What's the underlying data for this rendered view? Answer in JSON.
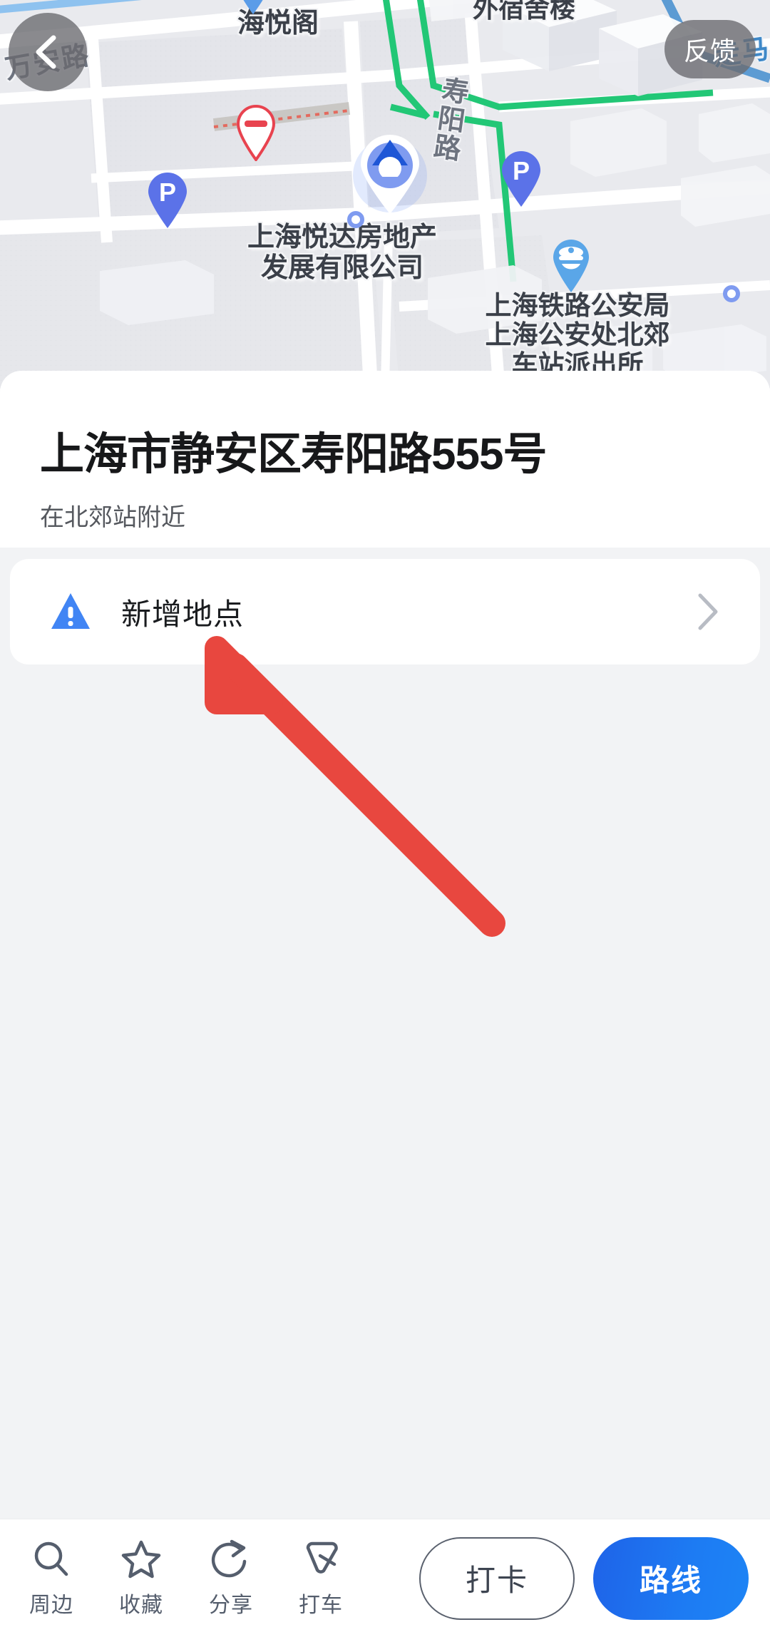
{
  "map": {
    "back_button": {
      "name": "back",
      "icon": "chevron-left-icon"
    },
    "feedback_button": {
      "label": "反馈"
    },
    "road_labels": [
      {
        "text": "万安路"
      },
      {
        "text": "寿阳路"
      },
      {
        "text": "走马"
      }
    ],
    "place_labels": [
      {
        "text": "海悦阁"
      },
      {
        "text": "外宿舍楼"
      },
      {
        "text": "上海悦达房地产\n发展有限公司"
      },
      {
        "text": "上海铁路公安局\n上海公安处北郊\n车站派出所"
      }
    ],
    "markers": [
      {
        "type": "parking-pin",
        "label": "P"
      },
      {
        "type": "parking-pin",
        "label": "P"
      },
      {
        "type": "no-entry-pin",
        "label": ""
      },
      {
        "type": "police-pin",
        "label": ""
      },
      {
        "type": "current-location-pin",
        "label": ""
      }
    ],
    "colors": {
      "pin_blue": "#5b72e8",
      "no_entry_red": "#e8434f",
      "police_blue": "#5aa6e8",
      "road_green": "#22c776",
      "road_river_blue": "#5aa0d8",
      "map_background": "#e9eaee"
    }
  },
  "sheet": {
    "title": "上海市静安区寿阳路555号",
    "subtitle": "在北郊站附近",
    "add_place": {
      "label": "新增地点",
      "icon": "warning-triangle-icon",
      "chevron": "chevron-right-icon",
      "icon_color": "#4185f4"
    }
  },
  "annotation": {
    "type": "arrow",
    "color": "#e8473f",
    "points_to": "新增地点"
  },
  "bottom_bar": {
    "tools": [
      {
        "label": "周边",
        "icon": "search-icon"
      },
      {
        "label": "收藏",
        "icon": "star-icon"
      },
      {
        "label": "分享",
        "icon": "share-icon"
      },
      {
        "label": "打车",
        "icon": "taxi-icon"
      }
    ],
    "checkin_label": "打卡",
    "route_label": "路线",
    "route_color": "#1d7bf3"
  }
}
